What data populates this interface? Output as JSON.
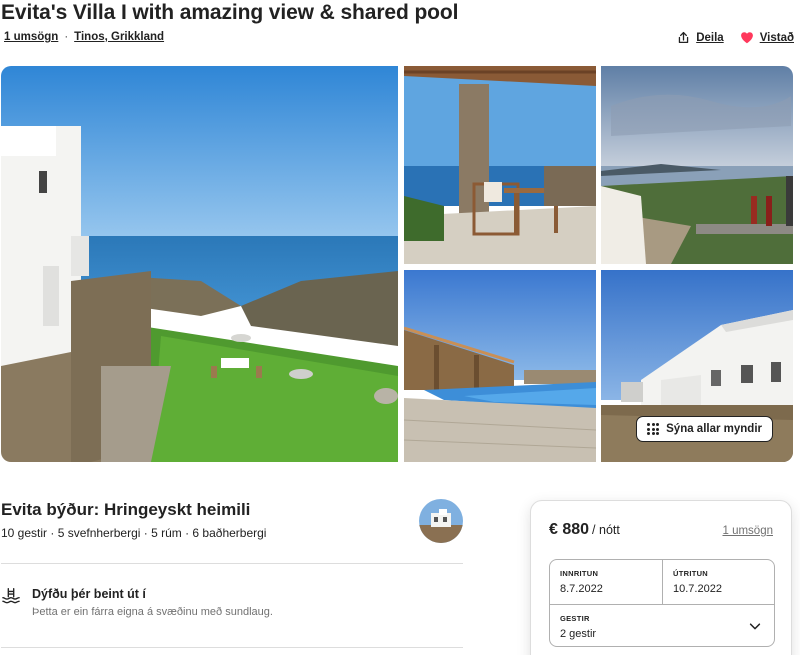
{
  "listing": {
    "title": "Evita's Villa I with amazing view & shared pool",
    "reviews_link": "1 umsögn",
    "separator": "·",
    "location": "Tinos, Grikkland",
    "share_label": "Deila",
    "save_label": "Vistað"
  },
  "gallery": {
    "show_all_label": "Sýna allar myndir"
  },
  "host": {
    "title": "Evita býður: Hringeyskt heimili",
    "details": "10 gestir · 5 svefnherbergi · 5 rúm · 6 baðherbergi"
  },
  "features": [
    {
      "icon": "pool-icon",
      "title": "Dýfðu þér beint út í",
      "description": "Þetta er ein fárra eigna á svæðinu með sundlaug."
    }
  ],
  "booking": {
    "price": "€ 880",
    "per_night": "/ nótt",
    "reviews_link": "1 umsögn",
    "checkin_label": "INNRITUN",
    "checkin_value": "8.7.2022",
    "checkout_label": "ÚTRITUN",
    "checkout_value": "10.7.2022",
    "guests_label": "GESTIR",
    "guests_value": "2 gestir"
  },
  "colors": {
    "heart": "#ff385c",
    "text": "#222222",
    "muted": "#717171",
    "border": "#dddddd"
  }
}
